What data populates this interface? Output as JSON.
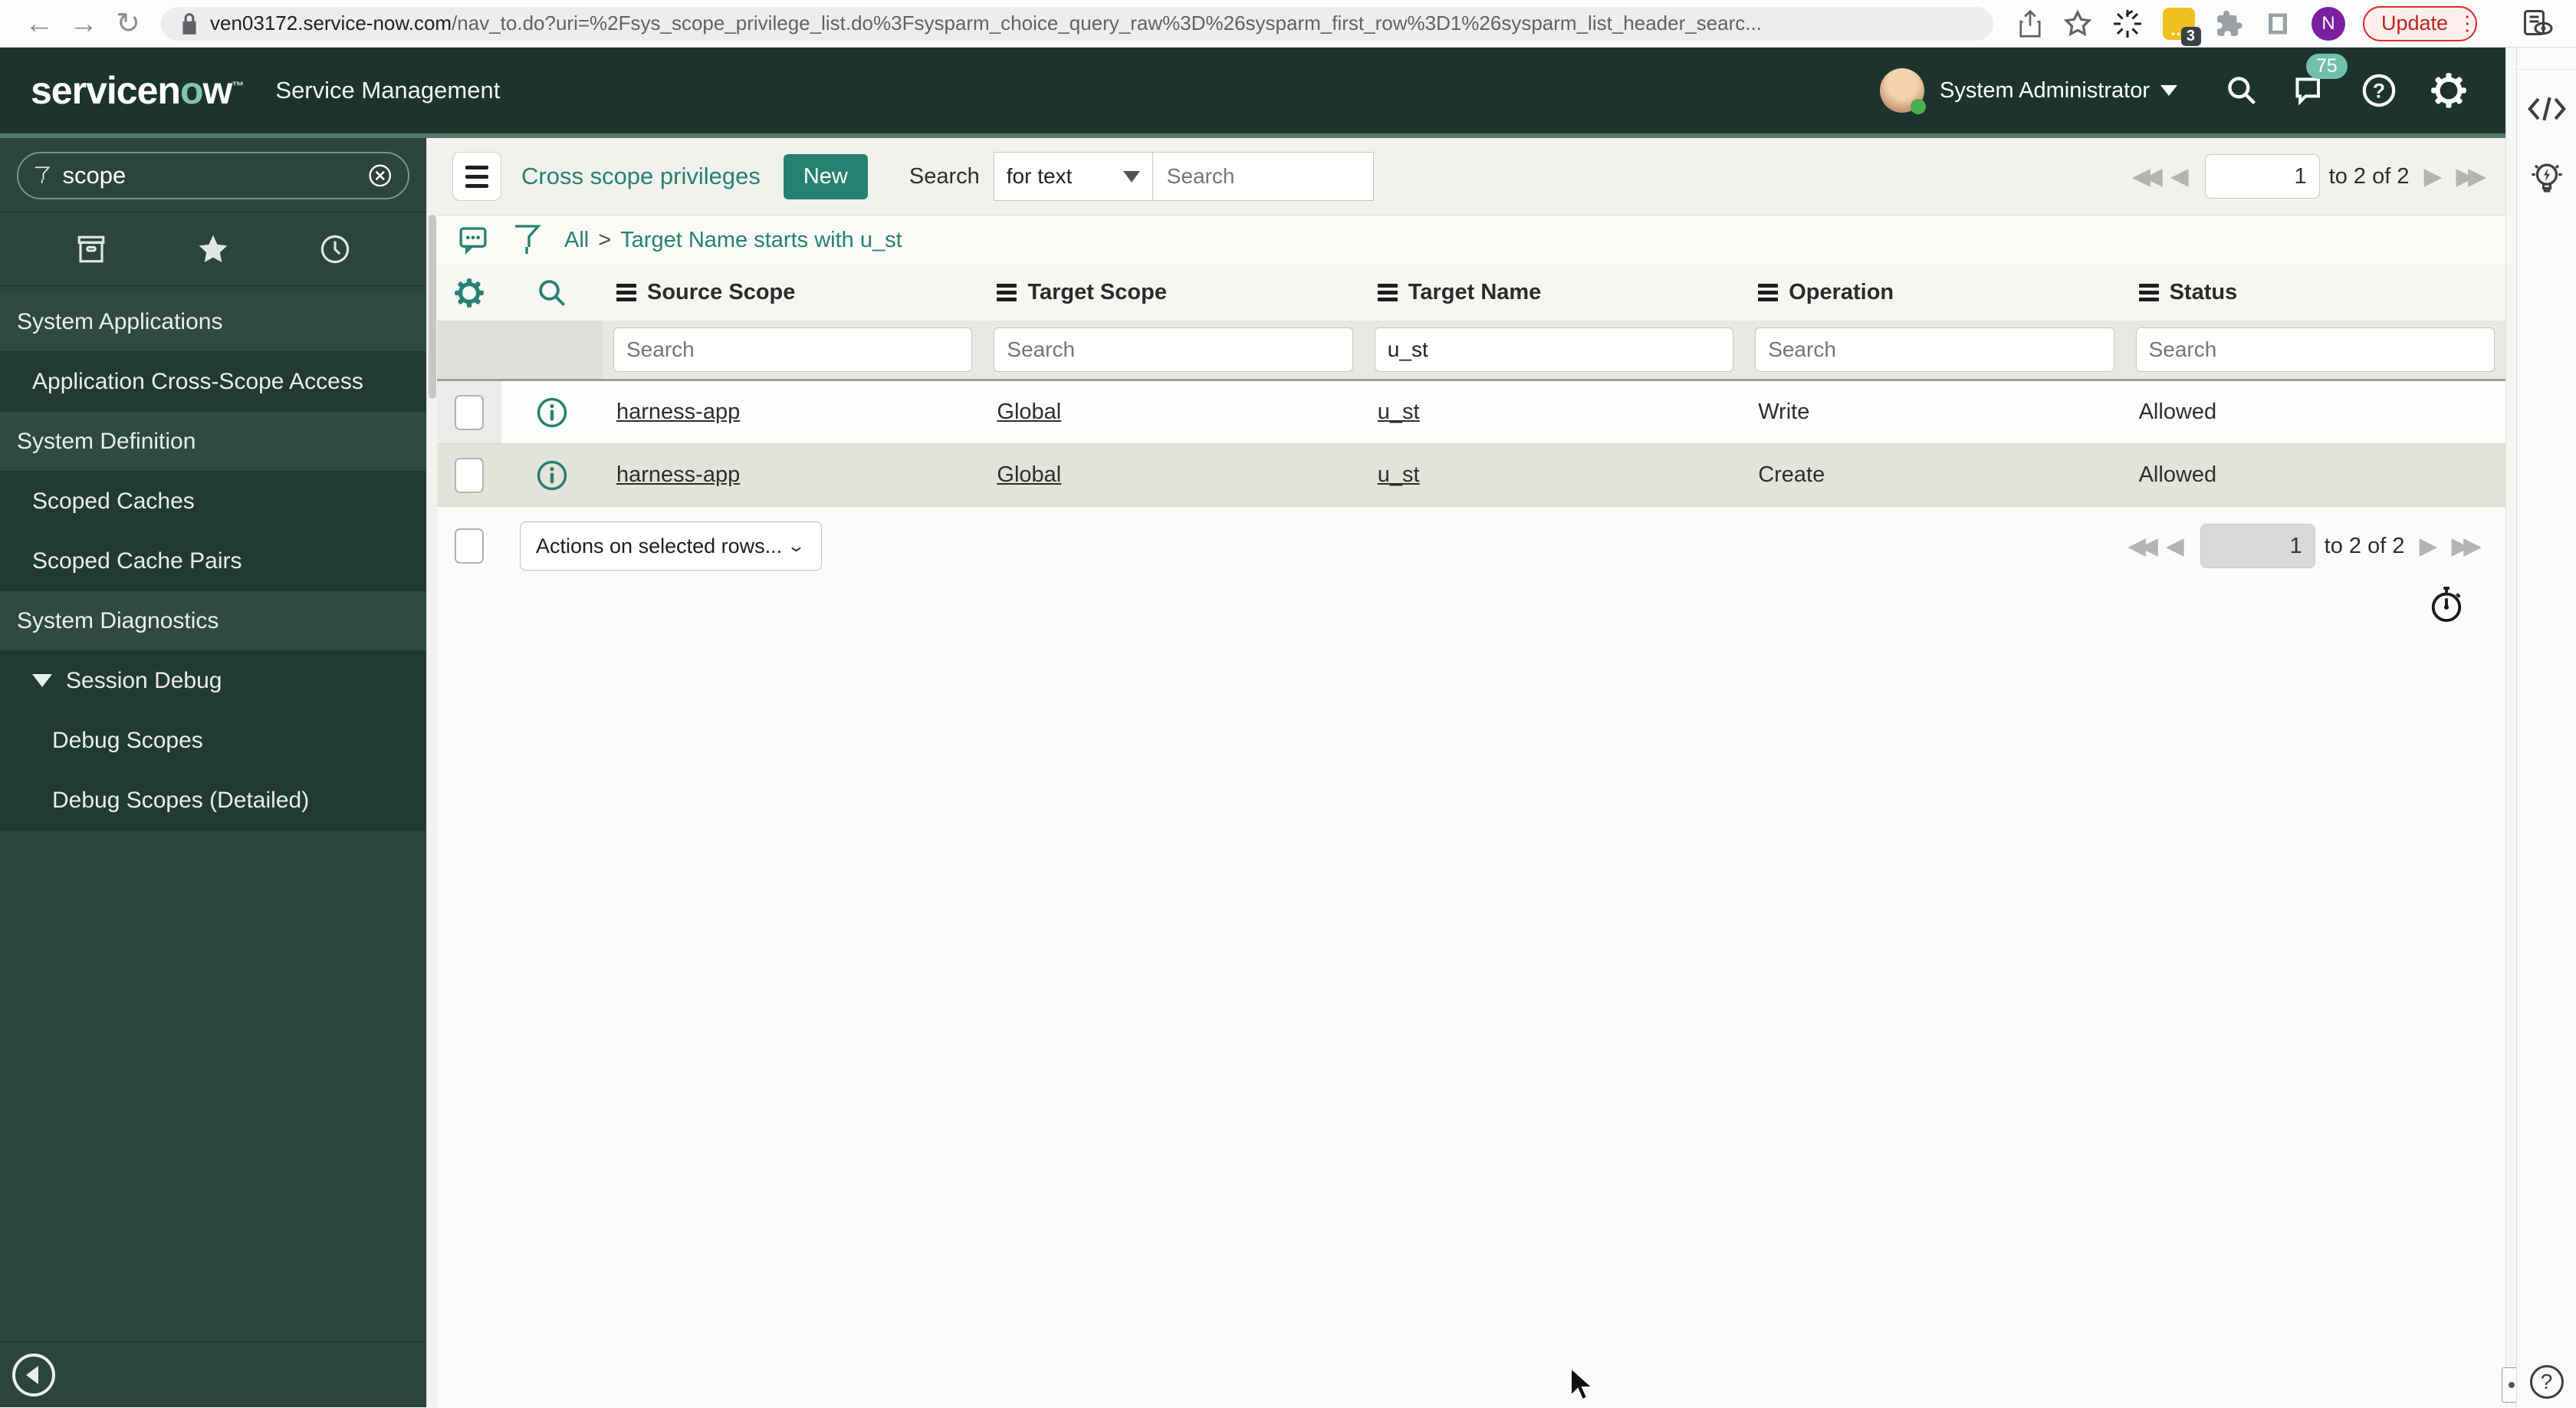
{
  "browser": {
    "url_domain": "ven03172.service-now.com",
    "url_path": "/nav_to.do?uri=%2Fsys_scope_privilege_list.do%3Fsysparm_choice_query_raw%3D%26sysparm_first_row%3D1%26sysparm_list_header_searc...",
    "update_label": "Update",
    "extension_badge": "3",
    "profile_initial": "N"
  },
  "header": {
    "logo_pre": "servicen",
    "logo_o": "o",
    "logo_post": "w",
    "product": "Service Management",
    "user_name": "System Administrator",
    "notification_count": "75"
  },
  "sidebar": {
    "filter_value": "scope",
    "items": [
      {
        "label": "System Applications",
        "type": "section"
      },
      {
        "label": "Application Cross-Scope Access",
        "type": "module"
      },
      {
        "label": "System Definition",
        "type": "section"
      },
      {
        "label": "Scoped Caches",
        "type": "module"
      },
      {
        "label": "Scoped Cache Pairs",
        "type": "module"
      },
      {
        "label": "System Diagnostics",
        "type": "section"
      },
      {
        "label": "Session Debug",
        "type": "expanded-group"
      },
      {
        "label": "Debug Scopes",
        "type": "submodule"
      },
      {
        "label": "Debug Scopes (Detailed)",
        "type": "submodule"
      }
    ]
  },
  "list": {
    "title": "Cross scope privileges",
    "new_button": "New",
    "search_label": "Search",
    "search_mode": "for text",
    "search_placeholder": "Search",
    "breadcrumb": {
      "root": "All",
      "separator": ">",
      "filter": "Target Name starts with u_st"
    },
    "columns": [
      "Source Scope",
      "Target Scope",
      "Target Name",
      "Operation",
      "Status"
    ],
    "filter_placeholder": "Search",
    "target_name_filter": "u_st",
    "rows": [
      {
        "source_scope": "harness-app",
        "target_scope": "Global",
        "target_name": "u_st",
        "operation": "Write",
        "status": "Allowed"
      },
      {
        "source_scope": "harness-app",
        "target_scope": "Global",
        "target_name": "u_st",
        "operation": "Create",
        "status": "Allowed"
      }
    ],
    "actions_placeholder": "Actions on selected rows...",
    "pagination": {
      "page": "1",
      "range_text": "to 2 of 2"
    }
  },
  "colors": {
    "accent_teal": "#278172",
    "banner_bg": "#1d342e",
    "sidebar_bg": "#2b453d",
    "update_red": "#c5221f"
  }
}
